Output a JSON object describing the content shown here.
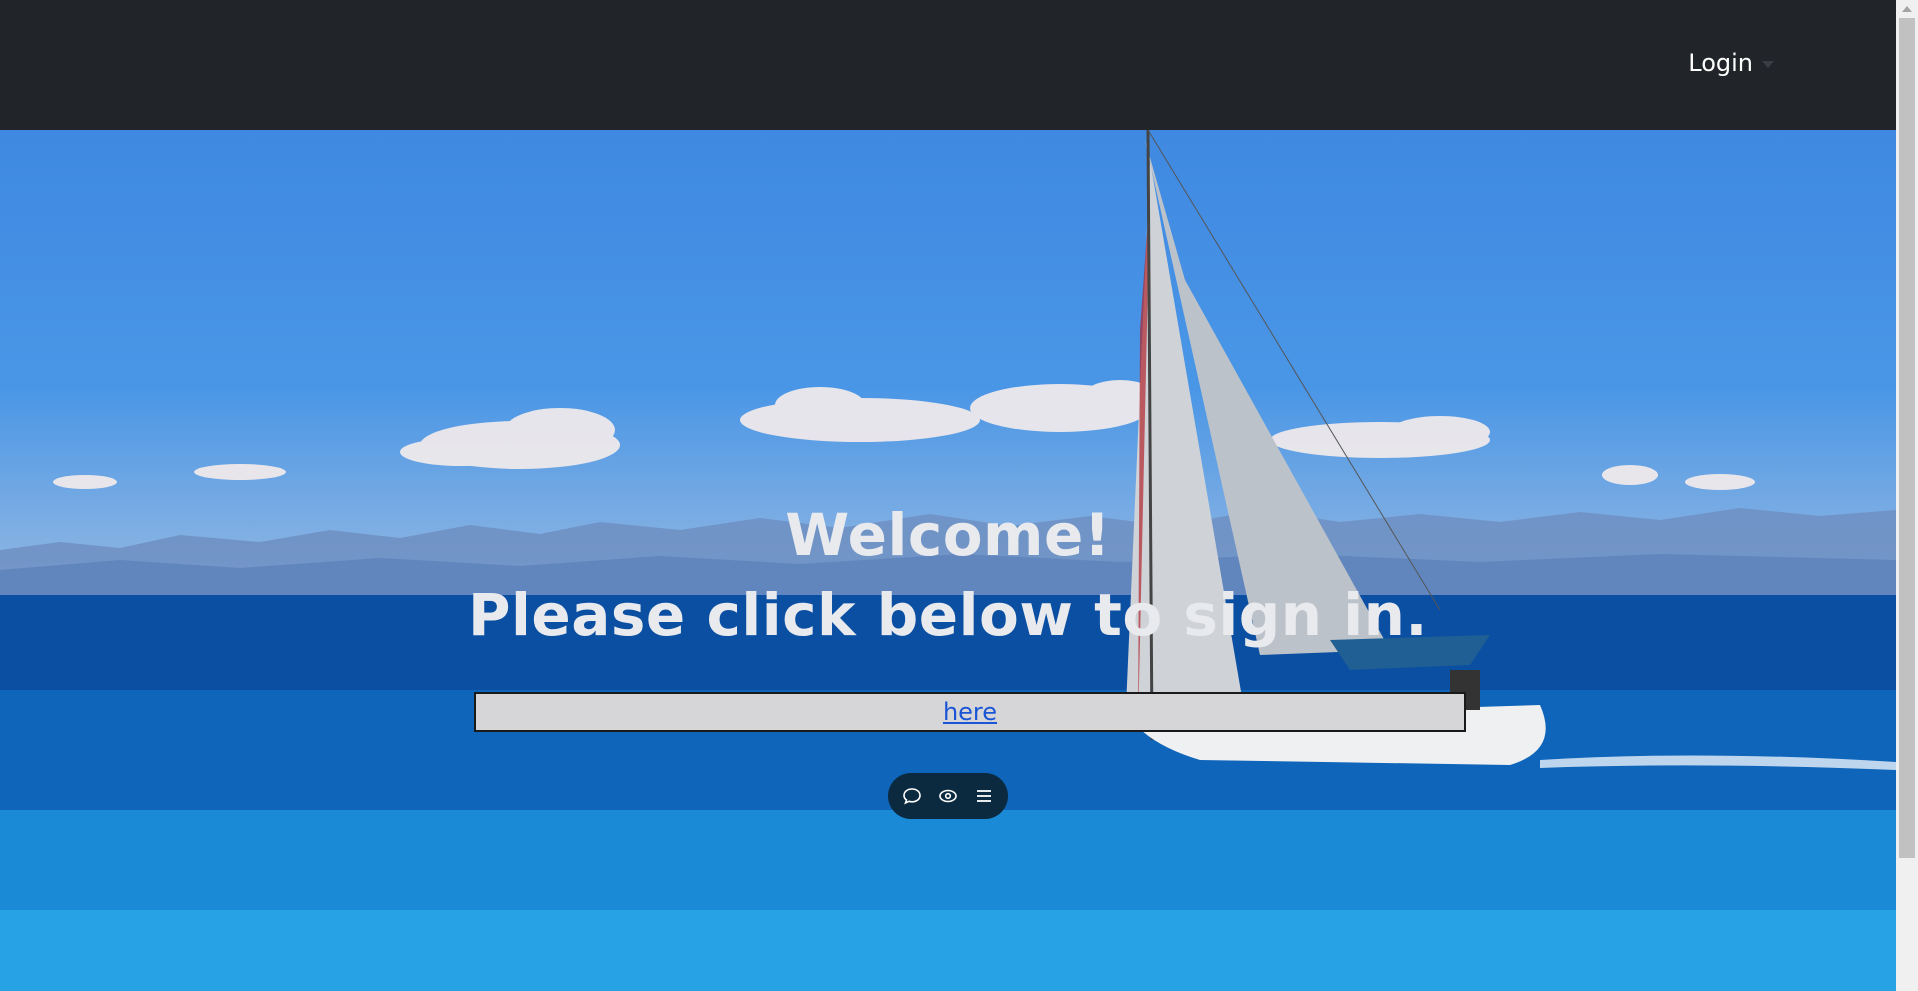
{
  "navbar": {
    "login_label": "Login"
  },
  "hero": {
    "headline_line1": "Welcome!",
    "headline_line2": "Please click below to sign in.",
    "signin_link": "here"
  },
  "toolbar": {
    "buttons": [
      {
        "icon": "chat-bubble-icon"
      },
      {
        "icon": "eye-icon"
      },
      {
        "icon": "menu-icon"
      }
    ]
  },
  "colors": {
    "navbar_bg": "#212428",
    "headline_text": "#e8eaee",
    "link": "#1a55d6",
    "signin_box_bg": "#d6d6d8",
    "toolbar_bg": "#0b2a3f"
  }
}
